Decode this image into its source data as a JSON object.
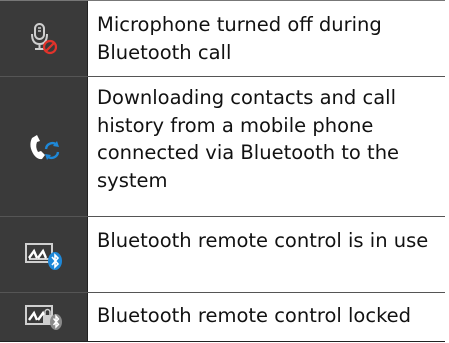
{
  "rows": [
    {
      "icon": "microphone-muted-icon",
      "text": "Microphone turned off during Bluetooth call"
    },
    {
      "icon": "phone-sync-icon",
      "text": "Downloading contacts and call history from a mobile phone connected via Bluetooth to the system"
    },
    {
      "icon": "bluetooth-remote-icon",
      "text": "Bluetooth remote control is in use"
    },
    {
      "icon": "bluetooth-remote-locked-icon",
      "text": "Bluetooth remote control locked"
    }
  ],
  "colors": {
    "icon_cell_bg": "#3a3a3a",
    "icon_red": "#e2332b",
    "icon_blue": "#1e88d8",
    "icon_white": "#ffffff"
  }
}
